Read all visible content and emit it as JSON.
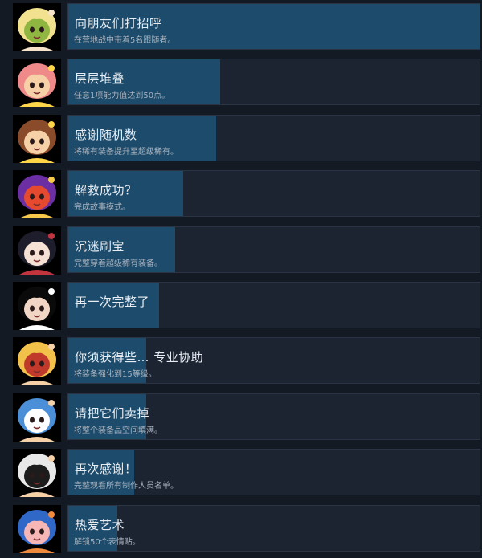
{
  "achievements": [
    {
      "title": "向朋友们打招呼",
      "description": "在营地战中带着5名跟随者。",
      "progress": 1.0,
      "icon": "blonde-girl-smile-icon",
      "colors": [
        "#f2e28f",
        "#8fb640",
        "#f7e3c9"
      ]
    },
    {
      "title": "层层堆叠",
      "description": "任意1项能力值达到50点。",
      "progress": 0.37,
      "icon": "pink-hair-girl-wink-icon",
      "colors": [
        "#f08a8a",
        "#f6d1a8",
        "#ffd54a"
      ]
    },
    {
      "title": "感谢随机数",
      "description": "将稀有装备提升至超级稀有。",
      "progress": 0.36,
      "icon": "brown-hair-girl-cheer-icon",
      "colors": [
        "#8a4b2a",
        "#f6d1a8",
        "#ffd54a"
      ]
    },
    {
      "title": "解救成功？",
      "description": "完成故事模式。",
      "progress": 0.28,
      "icon": "purple-chaos-icon",
      "colors": [
        "#6b2fa3",
        "#e64a2e",
        "#f6c94a"
      ]
    },
    {
      "title": "沉迷刷宝",
      "description": "完整穿着超级稀有装备。",
      "progress": 0.26,
      "icon": "dark-hair-girl-icon",
      "colors": [
        "#1d1d2b",
        "#f6e1d5",
        "#c2353f"
      ]
    },
    {
      "title": "再一次完整了",
      "description": "",
      "progress": 0.22,
      "icon": "feet-icon",
      "colors": [
        "#0a0a0a",
        "#f1d6c6",
        "#ffffff"
      ]
    },
    {
      "title": "你须获得些… 专业协助",
      "description": "将装备强化到15等级。",
      "progress": 0.19,
      "icon": "blonde-girl-sign-icon",
      "colors": [
        "#f2c14a",
        "#c0392b",
        "#f6d1a8"
      ]
    },
    {
      "title": "请把它们卖掉",
      "description": "将整个装备品空间填满。",
      "progress": 0.19,
      "icon": "blue-hair-girl-icon",
      "colors": [
        "#4a8fd8",
        "#ffffff",
        "#f6d1a8"
      ]
    },
    {
      "title": "再次感谢！",
      "description": "完整观看所有制作人员名单。",
      "progress": 0.16,
      "icon": "white-hair-maid-icon",
      "colors": [
        "#e8e8e8",
        "#1c1c1c",
        "#f6d1a8"
      ]
    },
    {
      "title": "热爱艺术",
      "description": "解锁50个表情贴。",
      "progress": 0.12,
      "icon": "blue-hair-girl-fallen-icon",
      "colors": [
        "#2f68c7",
        "#f6b6b6",
        "#f08a3c"
      ]
    }
  ]
}
